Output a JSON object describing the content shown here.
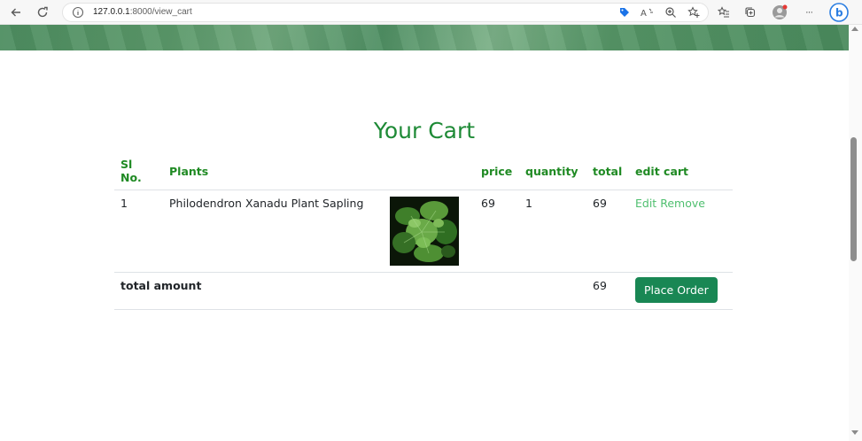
{
  "browser": {
    "url_host": "127.0.0.1",
    "url_path": ":8000/view_cart",
    "icons": [
      "back-icon",
      "refresh-icon",
      "info-icon",
      "tag-icon",
      "read-aloud-icon",
      "zoom-icon",
      "add-favorite-icon",
      "favorites-icon",
      "collections-icon",
      "profile-icon",
      "more-icon",
      "bing-icon"
    ],
    "more_label": "···"
  },
  "cart": {
    "title": "Your Cart",
    "headers": {
      "sl": "Sl No.",
      "plants": "Plants",
      "price": "price",
      "quantity": "quantity",
      "total": "total",
      "edit": "edit cart"
    },
    "items": [
      {
        "sl": "1",
        "name": "Philodendron Xanadu Plant Sapling",
        "price": "69",
        "quantity": "1",
        "total": "69",
        "edit_label": "Edit",
        "remove_label": "Remove"
      }
    ],
    "total_label": "total amount",
    "total_amount": "69",
    "place_order_label": "Place Order"
  },
  "colors": {
    "accent": "#1e8a36",
    "link": "#4fbf6f",
    "button": "#198754"
  }
}
